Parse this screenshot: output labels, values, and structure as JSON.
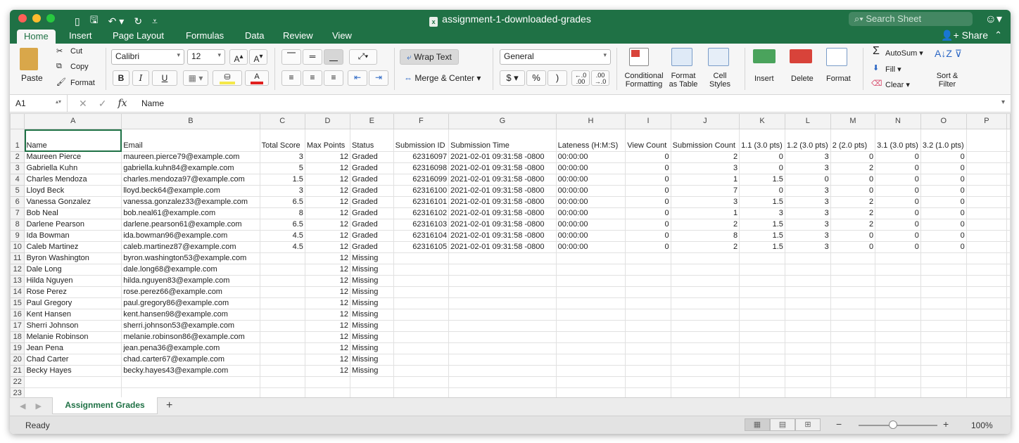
{
  "window": {
    "title": "assignment-1-downloaded-grades",
    "search_placeholder": "Search Sheet"
  },
  "ribbon_tabs": [
    "Home",
    "Insert",
    "Page Layout",
    "Formulas",
    "Data",
    "Review",
    "View"
  ],
  "share_label": "Share",
  "ribbon": {
    "paste": "Paste",
    "cut": "Cut",
    "copy": "Copy",
    "format_painter": "Format",
    "font_name": "Calibri",
    "font_size": "12",
    "bold": "B",
    "italic": "I",
    "underline": "U",
    "wrap_text": "Wrap Text",
    "merge_center": "Merge & Center",
    "number_format": "General",
    "currency": "$",
    "percent": "%",
    "comma": ")",
    "conditional_formatting_1": "Conditional",
    "conditional_formatting_2": "Formatting",
    "format_as_table_1": "Format",
    "format_as_table_2": "as Table",
    "cell_styles_1": "Cell",
    "cell_styles_2": "Styles",
    "insert": "Insert",
    "delete": "Delete",
    "format": "Format",
    "autosum": "AutoSum",
    "fill": "Fill",
    "clear": "Clear",
    "sort_filter_1": "Sort &",
    "sort_filter_2": "Filter"
  },
  "formula_bar": {
    "name_box": "A1",
    "fx": "fx",
    "value": "Name"
  },
  "columns": [
    "A",
    "B",
    "C",
    "D",
    "E",
    "F",
    "G",
    "H",
    "I",
    "J",
    "K",
    "L",
    "M",
    "N",
    "O",
    "P"
  ],
  "headers": [
    "Name",
    "Email",
    "Total Score",
    "Max Points",
    "Status",
    "Submission ID",
    "Submission Time",
    "Lateness (H:M:S)",
    "View Count",
    "Submission Count",
    "1.1 (3.0 pts)",
    "1.2 (3.0 pts)",
    "2 (2.0 pts)",
    "3.1 (3.0 pts)",
    "3.2 (1.0 pts)",
    ""
  ],
  "rows": [
    [
      "Maureen Pierce",
      "maureen.pierce79@example.com",
      "3",
      "12",
      "Graded",
      "62316097",
      "2021-02-01 09:31:58 -0800",
      "00:00:00",
      "0",
      "2",
      "0",
      "3",
      "0",
      "0",
      "0",
      ""
    ],
    [
      "Gabriella Kuhn",
      "gabriella.kuhn84@example.com",
      "5",
      "12",
      "Graded",
      "62316098",
      "2021-02-01 09:31:58 -0800",
      "00:00:00",
      "0",
      "3",
      "0",
      "3",
      "2",
      "0",
      "0",
      ""
    ],
    [
      "Charles Mendoza",
      "charles.mendoza97@example.com",
      "1.5",
      "12",
      "Graded",
      "62316099",
      "2021-02-01 09:31:58 -0800",
      "00:00:00",
      "0",
      "1",
      "1.5",
      "0",
      "0",
      "0",
      "0",
      ""
    ],
    [
      "Lloyd Beck",
      "lloyd.beck64@example.com",
      "3",
      "12",
      "Graded",
      "62316100",
      "2021-02-01 09:31:58 -0800",
      "00:00:00",
      "0",
      "7",
      "0",
      "3",
      "0",
      "0",
      "0",
      ""
    ],
    [
      "Vanessa Gonzalez",
      "vanessa.gonzalez33@example.com",
      "6.5",
      "12",
      "Graded",
      "62316101",
      "2021-02-01 09:31:58 -0800",
      "00:00:00",
      "0",
      "3",
      "1.5",
      "3",
      "2",
      "0",
      "0",
      ""
    ],
    [
      "Bob Neal",
      "bob.neal61@example.com",
      "8",
      "12",
      "Graded",
      "62316102",
      "2021-02-01 09:31:58 -0800",
      "00:00:00",
      "0",
      "1",
      "3",
      "3",
      "2",
      "0",
      "0",
      ""
    ],
    [
      "Darlene Pearson",
      "darlene.pearson61@example.com",
      "6.5",
      "12",
      "Graded",
      "62316103",
      "2021-02-01 09:31:58 -0800",
      "00:00:00",
      "0",
      "2",
      "1.5",
      "3",
      "2",
      "0",
      "0",
      ""
    ],
    [
      "Ida Bowman",
      "ida.bowman96@example.com",
      "4.5",
      "12",
      "Graded",
      "62316104",
      "2021-02-01 09:31:58 -0800",
      "00:00:00",
      "0",
      "8",
      "1.5",
      "3",
      "0",
      "0",
      "0",
      ""
    ],
    [
      "Caleb Martinez",
      "caleb.martinez87@example.com",
      "4.5",
      "12",
      "Graded",
      "62316105",
      "2021-02-01 09:31:58 -0800",
      "00:00:00",
      "0",
      "2",
      "1.5",
      "3",
      "0",
      "0",
      "0",
      ""
    ],
    [
      "Byron Washington",
      "byron.washington53@example.com",
      "",
      "12",
      "Missing",
      "",
      "",
      "",
      "",
      "",
      "",
      "",
      "",
      "",
      "",
      ""
    ],
    [
      "Dale Long",
      "dale.long68@example.com",
      "",
      "12",
      "Missing",
      "",
      "",
      "",
      "",
      "",
      "",
      "",
      "",
      "",
      "",
      ""
    ],
    [
      "Hilda Nguyen",
      "hilda.nguyen83@example.com",
      "",
      "12",
      "Missing",
      "",
      "",
      "",
      "",
      "",
      "",
      "",
      "",
      "",
      "",
      ""
    ],
    [
      "Rose Perez",
      "rose.perez66@example.com",
      "",
      "12",
      "Missing",
      "",
      "",
      "",
      "",
      "",
      "",
      "",
      "",
      "",
      "",
      ""
    ],
    [
      "Paul Gregory",
      "paul.gregory86@example.com",
      "",
      "12",
      "Missing",
      "",
      "",
      "",
      "",
      "",
      "",
      "",
      "",
      "",
      "",
      ""
    ],
    [
      "Kent Hansen",
      "kent.hansen98@example.com",
      "",
      "12",
      "Missing",
      "",
      "",
      "",
      "",
      "",
      "",
      "",
      "",
      "",
      "",
      ""
    ],
    [
      "Sherri Johnson",
      "sherri.johnson53@example.com",
      "",
      "12",
      "Missing",
      "",
      "",
      "",
      "",
      "",
      "",
      "",
      "",
      "",
      "",
      ""
    ],
    [
      "Melanie Robinson",
      "melanie.robinson86@example.com",
      "",
      "12",
      "Missing",
      "",
      "",
      "",
      "",
      "",
      "",
      "",
      "",
      "",
      "",
      ""
    ],
    [
      "Jean Pena",
      "jean.pena36@example.com",
      "",
      "12",
      "Missing",
      "",
      "",
      "",
      "",
      "",
      "",
      "",
      "",
      "",
      "",
      ""
    ],
    [
      "Chad Carter",
      "chad.carter67@example.com",
      "",
      "12",
      "Missing",
      "",
      "",
      "",
      "",
      "",
      "",
      "",
      "",
      "",
      "",
      ""
    ],
    [
      "Becky Hayes",
      "becky.hayes43@example.com",
      "",
      "12",
      "Missing",
      "",
      "",
      "",
      "",
      "",
      "",
      "",
      "",
      "",
      "",
      ""
    ],
    [
      "",
      "",
      "",
      "",
      "",
      "",
      "",
      "",
      "",
      "",
      "",
      "",
      "",
      "",
      "",
      ""
    ],
    [
      "",
      "",
      "",
      "",
      "",
      "",
      "",
      "",
      "",
      "",
      "",
      "",
      "",
      "",
      "",
      ""
    ]
  ],
  "sheet_tab": "Assignment Grades",
  "status": "Ready",
  "zoom": "100%",
  "colors": {
    "accent": "#1f7145"
  }
}
